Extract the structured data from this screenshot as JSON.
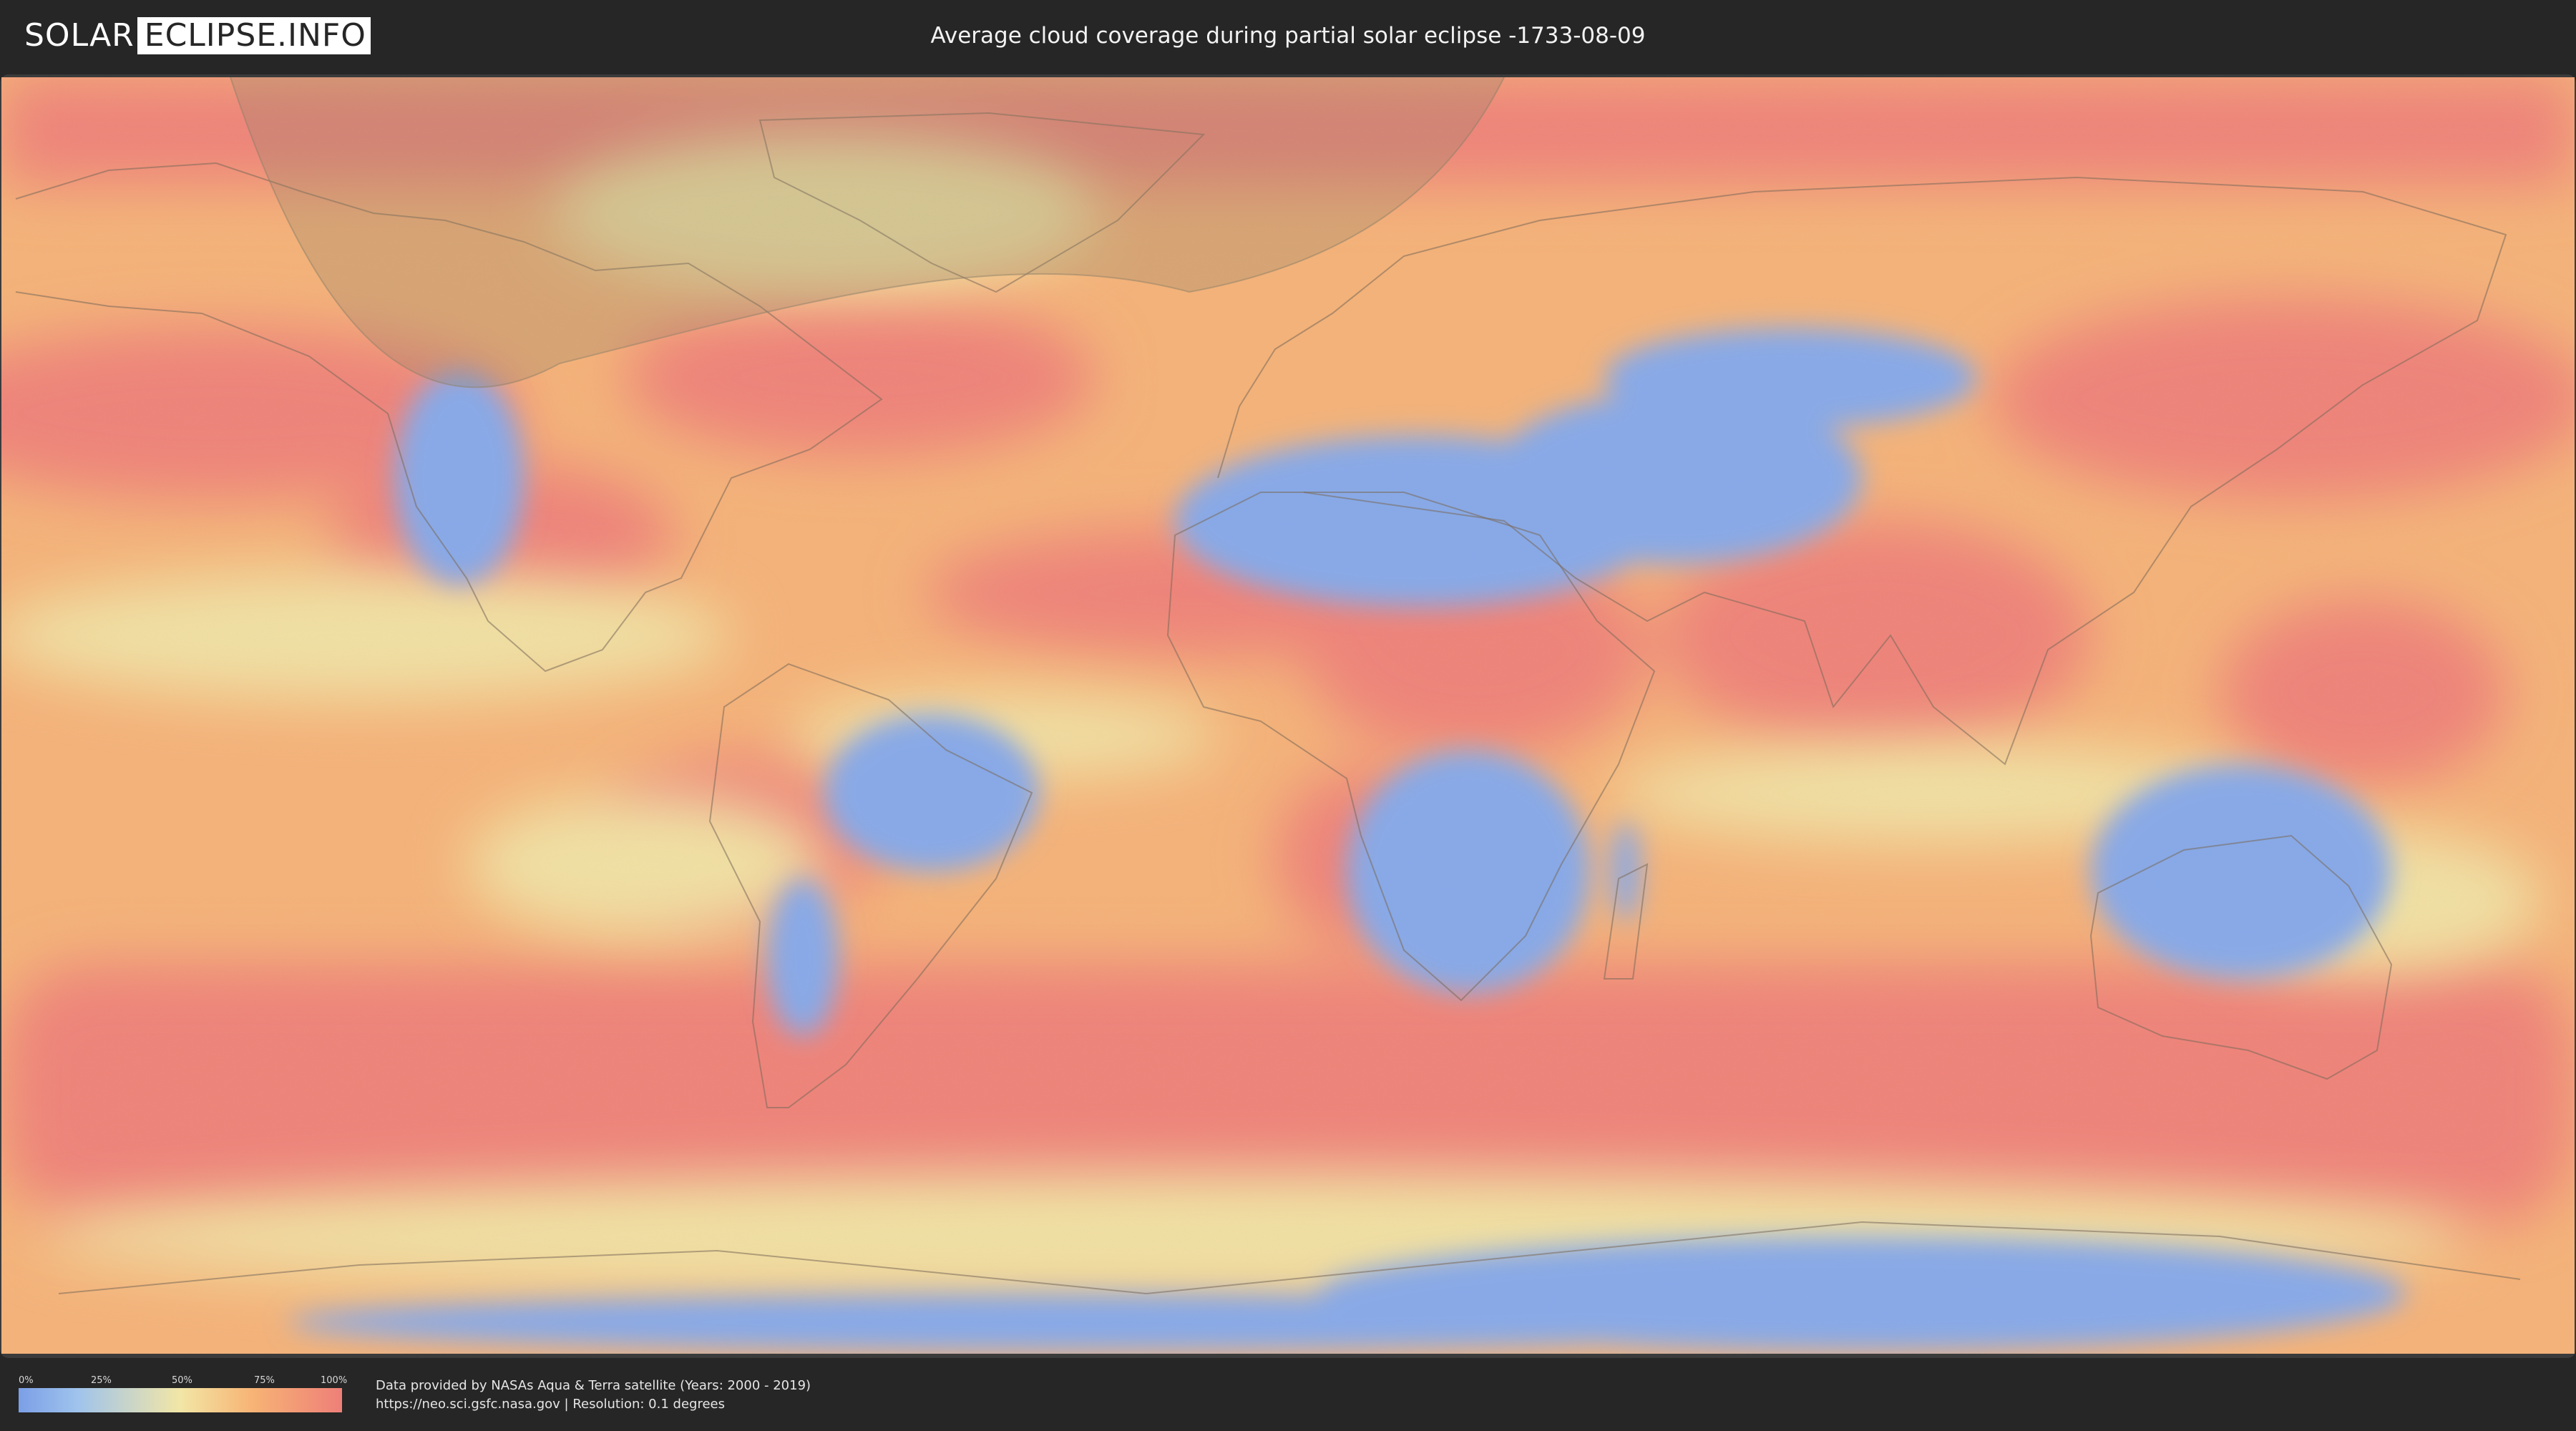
{
  "header": {
    "logo_left": "SOLAR",
    "logo_right": "ECLIPSE.INFO",
    "title": "Average cloud coverage during partial solar eclipse -1733-08-09"
  },
  "map": {
    "colors": {
      "clear": "#7b9fe6",
      "light": "#9fc3ec",
      "mid": "#f2e6a6",
      "heavy": "#f7b475",
      "overcast": "#ee7f78",
      "eclipse_shade": "#8c8068"
    }
  },
  "legend": {
    "ticks": [
      "0%",
      "25%",
      "50%",
      "75%",
      "100%"
    ]
  },
  "footer": {
    "credit_line1": "Data provided by NASAs Aqua & Terra satellite (Years: 2000 - 2019)",
    "credit_line2": "https://neo.sci.gsfc.nasa.gov | Resolution: 0.1 degrees"
  }
}
